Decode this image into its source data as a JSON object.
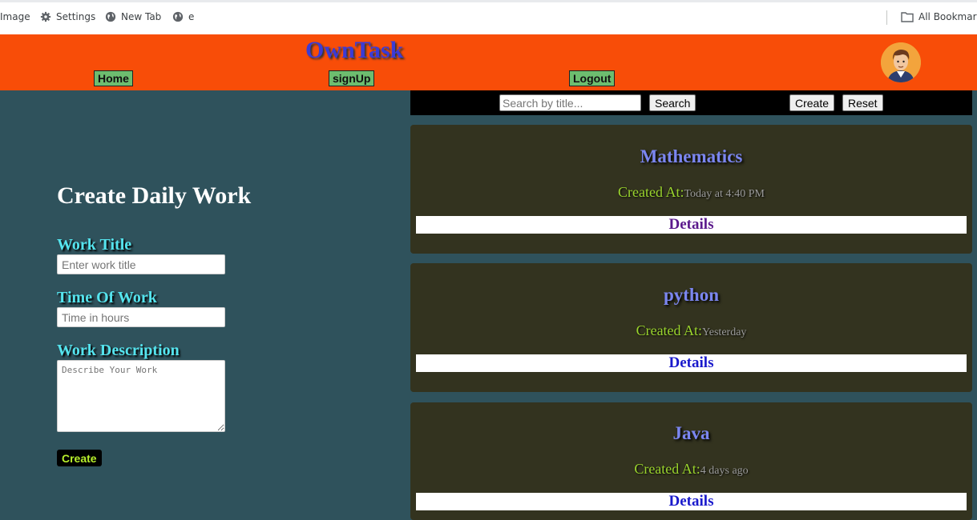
{
  "bookmarks": {
    "items": [
      {
        "label": "Image",
        "icon": "none"
      },
      {
        "label": "Settings",
        "icon": "gear-icon"
      },
      {
        "label": "New Tab",
        "icon": "globe-icon"
      },
      {
        "label": "e",
        "icon": "globe-icon"
      }
    ],
    "all_bookmarks": "All Bookmark"
  },
  "header": {
    "brand": "OwnTask",
    "nav": [
      "Home",
      "signUp",
      "Logout"
    ],
    "color": "#f84d08"
  },
  "form": {
    "title": "Create Daily Work",
    "work_title_label": "Work Title",
    "work_title_placeholder": "Enter work title",
    "time_label": "Time Of Work",
    "time_placeholder": "Time in hours",
    "desc_label": "Work Description",
    "desc_placeholder": "Describe Your Work",
    "create_label": "Create"
  },
  "search": {
    "placeholder": "Search by title...",
    "search_label": "Search",
    "create_label": "Create",
    "reset_label": "Reset"
  },
  "cards": [
    {
      "title": "Mathematics",
      "created_label": "Created At:",
      "created_time": "Today at 4:40 PM",
      "details": "Details",
      "details_color": "#5b1a8c"
    },
    {
      "title": "python",
      "created_label": "Created At:",
      "created_time": "Yesterday",
      "details": "Details",
      "details_color": "#1a1acc"
    },
    {
      "title": "Java",
      "created_label": "Created At:",
      "created_time": "4 days ago",
      "details": "Details",
      "details_color": "#1a1acc"
    }
  ]
}
